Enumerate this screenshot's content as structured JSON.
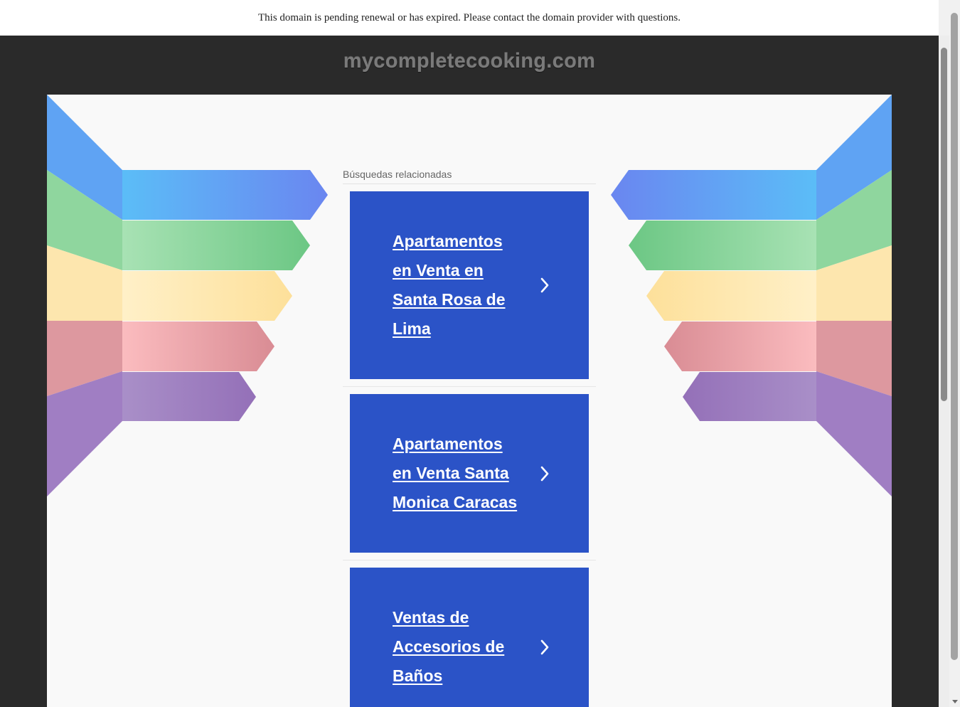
{
  "notice": {
    "text": "This domain is pending renewal or has expired. Please contact the domain provider with questions."
  },
  "header": {
    "domain": "mycompletecooking.com"
  },
  "related": {
    "heading": "Búsquedas relacionadas",
    "items": [
      {
        "label": "Apartamentos en Venta en Santa Rosa de Lima"
      },
      {
        "label": "Apartamentos en Venta Santa Monica Caracas"
      },
      {
        "label": "Ventas de Accesorios de Baños"
      }
    ]
  },
  "colors": {
    "card": "#2b53c7",
    "dark_bg": "#2a2a2a",
    "panel_bg": "#f9f9f9",
    "ribbon_blue": "#5b8cf0",
    "ribbon_green": "#7cd08e",
    "ribbon_yellow": "#fde3a0",
    "ribbon_red": "#e99a9f",
    "ribbon_purple": "#9b7cc0"
  },
  "icons": {
    "card_arrow": "chevron-right-icon"
  }
}
